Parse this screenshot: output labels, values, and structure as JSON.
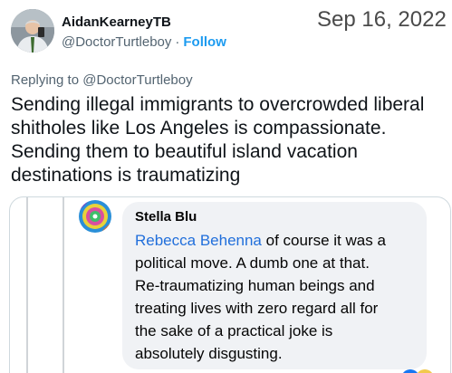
{
  "author": {
    "display_name": "AidanKearneyTB",
    "handle": "@DoctorTurtleboy",
    "separator": "·",
    "follow_label": "Follow"
  },
  "date_stamp": "Sep 16, 2022",
  "replying": {
    "prefix": "Replying to",
    "mention": "@DoctorTurtleboy"
  },
  "tweet": {
    "lines": [
      "Sending illegal immigrants to overcrowded liberal",
      "shitholes like Los Angeles is compassionate.",
      "Sending them to beautiful island vacation",
      "destinations is traumatizing"
    ]
  },
  "embedded_comment": {
    "commenter_name": "Stella Blu",
    "tagged_name": "Rebecca Behenna",
    "lines": [
      " of course it was a",
      "political move. A dumb one at that.",
      "Re-traumatizing human beings and",
      "treating lives with zero regard all for",
      "the sake of a practical joke is",
      "absolutely disgusting."
    ],
    "colors": {
      "bubble": "#f0f2f5",
      "tag_link": "#216fdb"
    }
  },
  "colors": {
    "follow_link": "#1d9bf0",
    "secondary_text": "#536471",
    "primary_text": "#0f1419"
  }
}
